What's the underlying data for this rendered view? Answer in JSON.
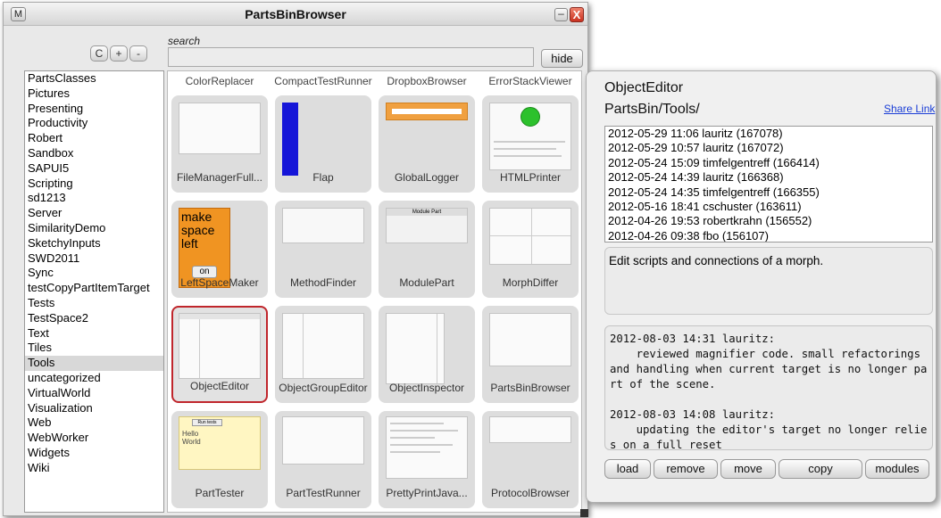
{
  "window": {
    "title": "PartsBinBrowser",
    "menu_label": "M",
    "min_label": "–",
    "close_label": "X"
  },
  "toolbar": {
    "refresh_label": "C",
    "add_label": "+",
    "remove_label": "-",
    "search_label": "search",
    "search_value": "",
    "hide_label": "hide"
  },
  "categories": [
    {
      "label": "PartsClasses"
    },
    {
      "label": "Pictures"
    },
    {
      "label": "Presenting"
    },
    {
      "label": "Productivity"
    },
    {
      "label": "Robert"
    },
    {
      "label": "Sandbox"
    },
    {
      "label": "SAPUI5"
    },
    {
      "label": "Scripting"
    },
    {
      "label": "sd1213"
    },
    {
      "label": "Server"
    },
    {
      "label": "SimilarityDemo"
    },
    {
      "label": "SketchyInputs"
    },
    {
      "label": "SWD2011"
    },
    {
      "label": "Sync"
    },
    {
      "label": "testCopyPartItemTarget"
    },
    {
      "label": "Tests"
    },
    {
      "label": "TestSpace2"
    },
    {
      "label": "Text"
    },
    {
      "label": "Tiles"
    },
    {
      "label": "Tools",
      "selected": true
    },
    {
      "label": "uncategorized"
    },
    {
      "label": "VirtualWorld"
    },
    {
      "label": "Visualization"
    },
    {
      "label": "Web"
    },
    {
      "label": "WebWorker"
    },
    {
      "label": "Widgets"
    },
    {
      "label": "Wiki"
    }
  ],
  "parts": {
    "top_row": [
      "ColorReplacer",
      "CompactTestRunner",
      "DropboxBrowser",
      "ErrorStackViewer"
    ],
    "rows": [
      [
        "FileManagerFull...",
        "Flap",
        "GlobalLogger",
        "HTMLPrinter"
      ],
      [
        "LeftSpaceMaker",
        "MethodFinder",
        "ModulePart",
        "MorphDiffer"
      ],
      [
        "ObjectEditor",
        "ObjectGroupEditor",
        "ObjectInspector",
        "PartsBinBrowser"
      ],
      [
        "PartTester",
        "PartTestRunner",
        "PrettyPrintJava...",
        "ProtocolBrowser"
      ]
    ],
    "selected": "ObjectEditor",
    "thumb_texts": {
      "leftspace_l1": "make",
      "leftspace_l2": "space",
      "leftspace_l3": "left",
      "leftspace_btn": "on",
      "modulepart_title": "Module Part",
      "parttester_btn": "Run tests",
      "parttester_l1": "Hello",
      "parttester_l2": "World"
    }
  },
  "editor": {
    "title": "ObjectEditor",
    "path": "PartsBin/Tools/",
    "share_link": "Share Link",
    "versions": [
      "2012-05-29 11:06 lauritz (167078)",
      "2012-05-29 10:57 lauritz (167072)",
      "2012-05-24 15:09 timfelgentreff (166414)",
      "2012-05-24 14:39 lauritz (166368)",
      "2012-05-24 14:35 timfelgentreff (166355)",
      "2012-05-16 18:41 cschuster (163611)",
      "2012-04-26 19:53 robertkrahn (156552)",
      "2012-04-26 09:38 fbo (156107)"
    ],
    "description": "Edit scripts and connections of a morph.",
    "log": "2012-08-03 14:31 lauritz:\n    reviewed magnifier code. small refactorings and handling when current target is no longer part of the scene.\n\n2012-08-03 14:08 lauritz:\n    updating the editor's target no longer relies on a full reset",
    "buttons": {
      "load": "load",
      "remove": "remove",
      "move": "move",
      "copy": "copy",
      "modules": "modules"
    }
  }
}
